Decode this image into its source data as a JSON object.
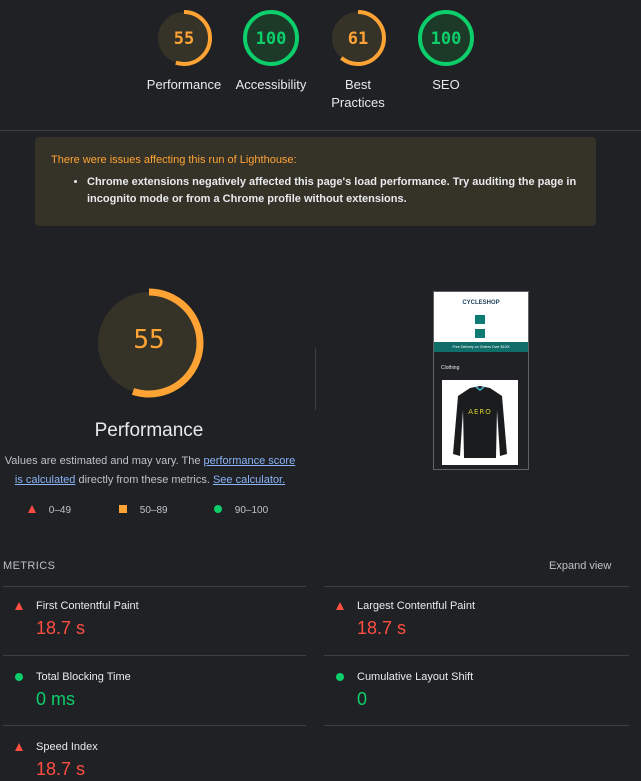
{
  "top_gauges": [
    {
      "score": "55",
      "label": "Performance",
      "color": "#ffa434",
      "fraction": 0.55
    },
    {
      "score": "100",
      "label": "Accessibility",
      "color": "#0cce6b",
      "fraction": 1.0
    },
    {
      "score": "61",
      "label": "Best Practices",
      "color": "#ffa434",
      "fraction": 0.61
    },
    {
      "score": "100",
      "label": "SEO",
      "color": "#0cce6b",
      "fraction": 1.0
    }
  ],
  "warning": {
    "title": "There were issues affecting this run of Lighthouse:",
    "item": "Chrome extensions negatively affected this page's load performance. Try auditing the page in incognito mode or from a Chrome profile without extensions."
  },
  "performance": {
    "score": "55",
    "fraction": 0.55,
    "title": "Performance",
    "desc_prefix": "Values are estimated and may vary. The ",
    "desc_link1": "performance score is calculated",
    "desc_middle": " directly from these metrics. ",
    "desc_link2": "See calculator."
  },
  "legend": [
    {
      "range": "0–49",
      "icon": "triangle-fail-icon",
      "color": "#ff4e42"
    },
    {
      "range": "50–89",
      "icon": "square-average-icon",
      "color": "#ffa434"
    },
    {
      "range": "90–100",
      "icon": "circle-pass-icon",
      "color": "#0cce6b"
    }
  ],
  "screenshot": {
    "brand": "CYCLESHOP",
    "banner": "Free Delivery on Orders Over $100!",
    "category": "Clothing",
    "jersey_text": "AERO"
  },
  "metrics": {
    "heading": "METRICS",
    "expand_label": "Expand view",
    "items": [
      {
        "title": "First Contentful Paint",
        "value": "18.7 s",
        "status": "fail"
      },
      {
        "title": "Largest Contentful Paint",
        "value": "18.7 s",
        "status": "fail"
      },
      {
        "title": "Total Blocking Time",
        "value": "0 ms",
        "status": "pass"
      },
      {
        "title": "Cumulative Layout Shift",
        "value": "0",
        "status": "pass"
      },
      {
        "title": "Speed Index",
        "value": "18.7 s",
        "status": "fail"
      }
    ]
  },
  "colors": {
    "fail": "#ff4e42",
    "average": "#ffa434",
    "pass": "#0cce6b",
    "link": "#8ab4f8"
  }
}
